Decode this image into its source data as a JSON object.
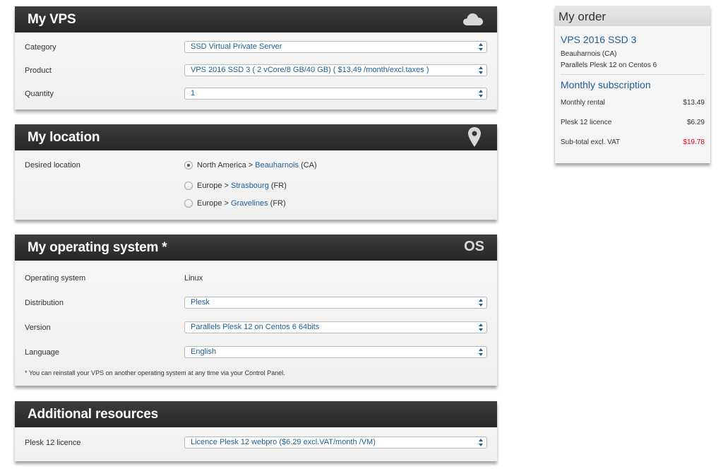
{
  "vps_panel": {
    "title": "My VPS",
    "icon": "cloud-icon",
    "rows": [
      {
        "label": "Category",
        "value": "SSD Virtual Private Server"
      },
      {
        "label": "Product",
        "value": "VPS 2016 SSD 3 ( 2 vCore/8 GB/40 GB) ( $13.49 /month/excl.taxes )"
      },
      {
        "label": "Quantity",
        "value": "1"
      }
    ]
  },
  "location_panel": {
    "title": "My location",
    "icon": "map-pin-icon",
    "label": "Desired location",
    "options": [
      {
        "region": "North America > ",
        "city": "Beauharnois",
        "code": " (CA)",
        "checked": true
      },
      {
        "region": "Europe > ",
        "city": "Strasbourg",
        "code": " (FR)",
        "checked": false
      },
      {
        "region": "Europe > ",
        "city": "Gravelines",
        "code": " (FR)",
        "checked": false
      }
    ]
  },
  "os_panel": {
    "title": "My operating system *",
    "icon_text": "OS",
    "os_label": "Operating system",
    "os_value": "Linux",
    "rows": [
      {
        "label": "Distribution",
        "value": "Plesk"
      },
      {
        "label": "Version",
        "value": "Parallels Plesk 12 on Centos 6 64bits"
      },
      {
        "label": "Language",
        "value": "English"
      }
    ],
    "footnote": "* You can reinstall your VPS on another operating system at any time via your Control Panel."
  },
  "resources_panel": {
    "title": "Additional resources",
    "rows": [
      {
        "label": "Plesk 12 licence",
        "value": "Licence Plesk 12 webpro ($6.29 excl.VAT/month /VM)"
      }
    ]
  },
  "order": {
    "title": "My order",
    "product": "VPS 2016 SSD 3",
    "location": "Beauharnois (CA)",
    "os": "Parallels Plesk 12 on Centos 6",
    "subscription_title": "Monthly subscription",
    "items": [
      {
        "label": "Monthly rental",
        "amount": "$13.49"
      },
      {
        "label": "Plesk 12 licence",
        "amount": "$6.29"
      },
      {
        "label": "Sub-total excl. VAT",
        "amount": "$19.78"
      }
    ],
    "colors": {
      "accent": "#1e5e96",
      "subtotal": "#e2001a"
    }
  }
}
